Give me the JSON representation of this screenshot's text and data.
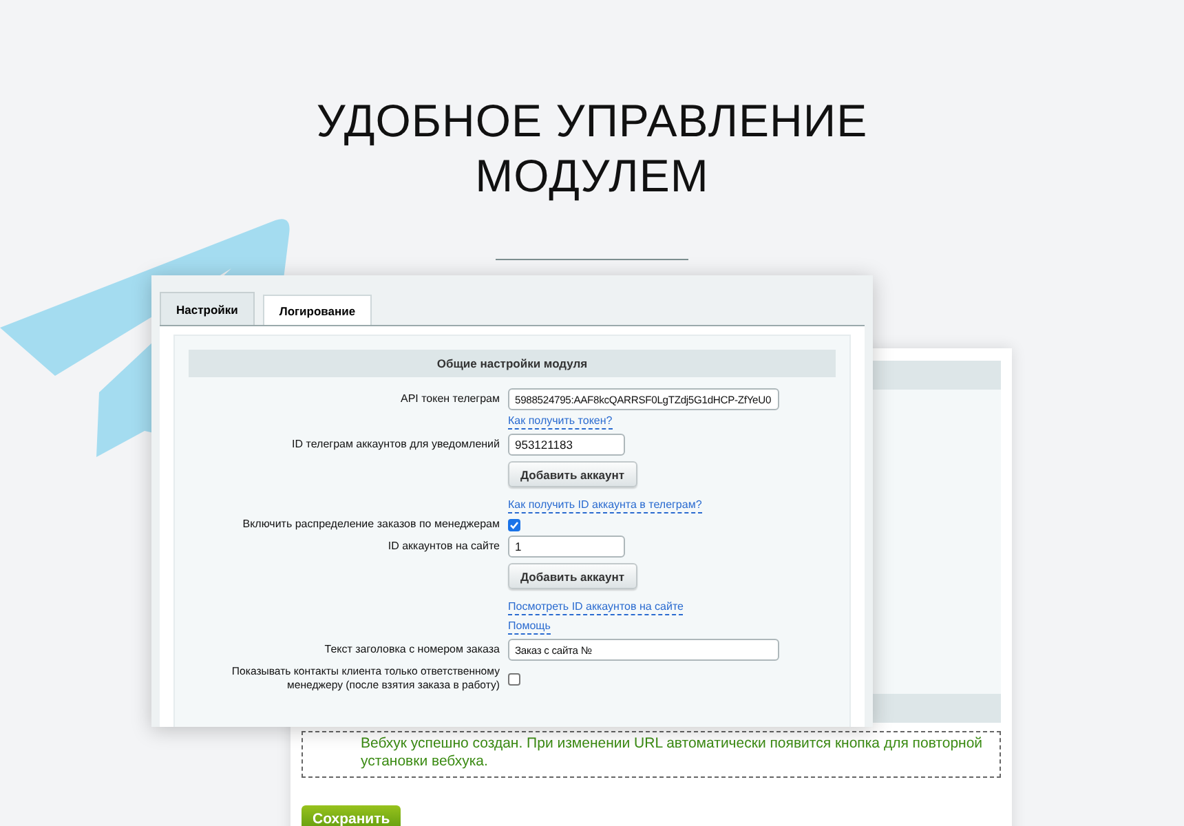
{
  "heading": "УДОБНОЕ УПРАВЛЕНИЕ МОДУЛЕМ",
  "tabs": [
    {
      "label": "Настройки",
      "selected": true
    },
    {
      "label": "Логирование",
      "selected": false
    }
  ],
  "section_title": "Общие настройки модуля",
  "rows": [
    {
      "kind": "wide_input",
      "label": "API токен телеграм",
      "value": "5988524795:AAF8kcQARRSF0LgTZdj5G1dHCP-ZfYeU0"
    },
    {
      "kind": "link",
      "text": "Как получить токен?"
    },
    {
      "kind": "input",
      "label": "ID телеграм аккаунтов для уведомлений",
      "value": "953121183"
    },
    {
      "kind": "button",
      "text": "Добавить аккаунт"
    },
    {
      "kind": "link",
      "text": "Как получить ID аккаунта в телеграм?"
    },
    {
      "kind": "checkbox",
      "label": "Включить распределение заказов по менеджерам",
      "checked": true
    },
    {
      "kind": "input",
      "label": "ID аккаунтов на сайте",
      "value": "1"
    },
    {
      "kind": "button",
      "text": "Добавить аккаунт"
    },
    {
      "kind": "link",
      "text": "Посмотреть ID аккаунтов на сайте"
    },
    {
      "kind": "link",
      "text": "Помощь"
    },
    {
      "kind": "wide_input",
      "label": "Текст заголовка с номером заказа",
      "value": "Заказ с сайта №"
    },
    {
      "kind": "checkbox",
      "label": "Показывать контакты клиента только ответственному менеджеру (после взятия заказа в работу)",
      "checked": false
    }
  ],
  "back_panel": {
    "message": "Вебхук успешно создан. При изменении URL автоматически появится кнопка для повторной установки вебхука.",
    "save_button": "Сохранить"
  }
}
